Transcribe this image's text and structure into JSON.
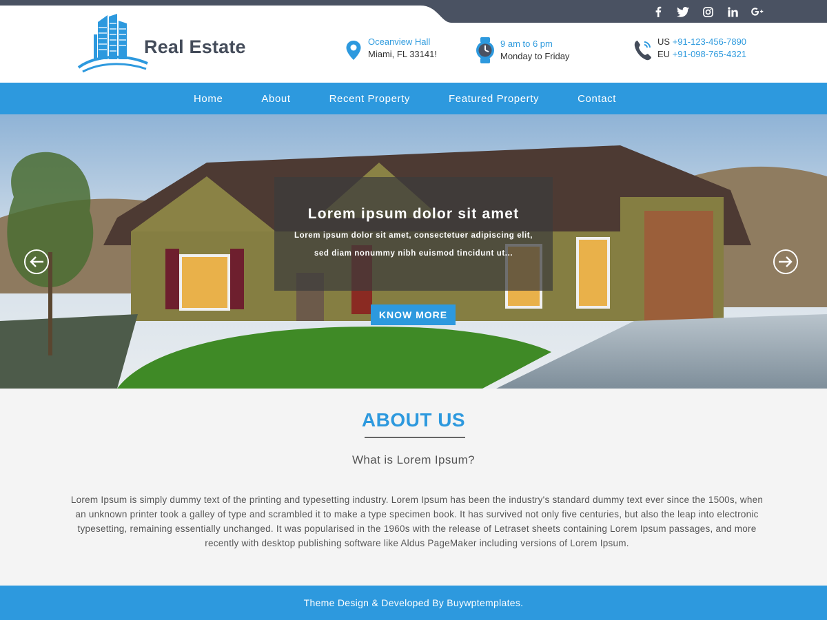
{
  "header": {
    "logo_text": "Real Estate",
    "address": {
      "line1": "Oceanview Hall",
      "line2": "Miami, FL 33141!"
    },
    "hours": {
      "line1": "9 am to 6 pm",
      "line2": "Monday to Friday"
    },
    "phones": [
      {
        "region": "US",
        "number": "+91-123-456-7890"
      },
      {
        "region": "EU",
        "number": "+91-098-765-4321"
      }
    ],
    "social": [
      "facebook-icon",
      "twitter-icon",
      "instagram-icon",
      "linkedin-icon",
      "google-plus-icon"
    ]
  },
  "nav": {
    "items": [
      {
        "label": "Home"
      },
      {
        "label": "About"
      },
      {
        "label": "Recent Property"
      },
      {
        "label": "Featured Property"
      },
      {
        "label": "Contact"
      }
    ]
  },
  "hero": {
    "title": "Lorem ipsum dolor sit amet",
    "text_line1": "Lorem ipsum dolor sit amet, consectetuer adipiscing elit,",
    "text_line2": "sed diam nonummy nibh euismod tincidunt ut...",
    "button_label": "KNOW MORE"
  },
  "about": {
    "title": "ABOUT US",
    "subtitle": "What is Lorem Ipsum?",
    "body": "Lorem Ipsum is simply dummy text of the printing and typesetting industry. Lorem Ipsum has been the industry's standard dummy text ever since the 1500s, when an unknown printer took a galley of type and scrambled it to make a type specimen book. It has survived not only five centuries, but also the leap into electronic typesetting, remaining essentially unchanged. It was popularised in the 1960s with the release of Letraset sheets containing Lorem Ipsum passages, and more recently with desktop publishing software like Aldus PageMaker including versions of Lorem Ipsum."
  },
  "footer": {
    "credit": "Theme Design & Developed By Buywptemplates."
  },
  "colors": {
    "accent": "#2d99de",
    "topbar": "#4a5262",
    "logo_text": "#444c5a"
  }
}
